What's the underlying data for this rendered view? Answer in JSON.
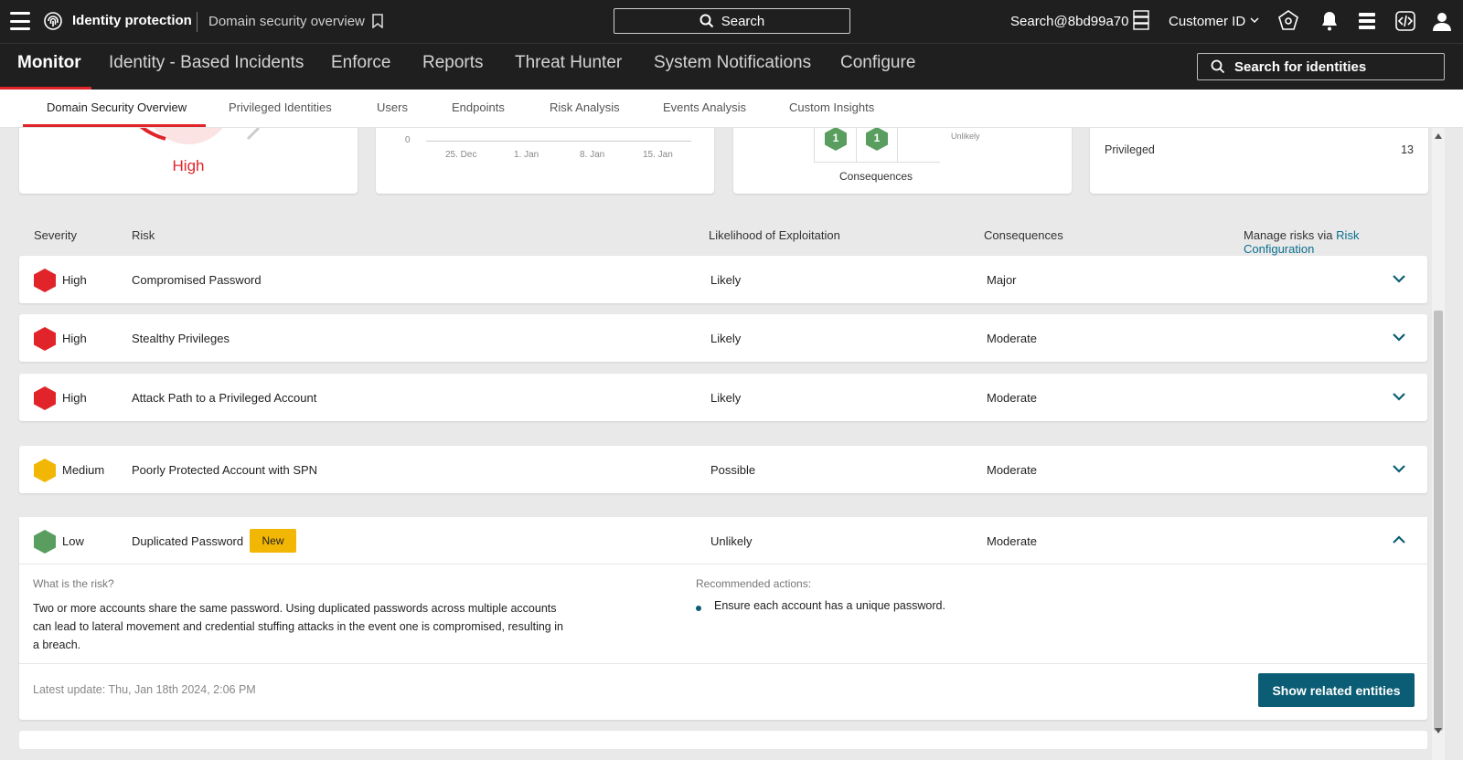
{
  "topbar": {
    "app_name": "Identity protection",
    "page_crumb": "Domain security overview",
    "search_label": "Search",
    "user": "Search@8bd99a70",
    "customer_id": "Customer ID"
  },
  "mainnav": {
    "items": [
      "Monitor",
      "Identity - Based Incidents",
      "Enforce",
      "Reports",
      "Threat Hunter",
      "System Notifications",
      "Configure"
    ],
    "active": "Monitor",
    "identity_search": "Search for identities"
  },
  "subtabs": {
    "items": [
      "Domain Security Overview",
      "Privileged Identities",
      "Users",
      "Endpoints",
      "Risk Analysis",
      "Events Analysis",
      "Custom Insights"
    ],
    "active": "Domain Security Overview"
  },
  "cards": {
    "risk_level": "High",
    "chart_zero": "0",
    "chart_dates": [
      "25. Dec",
      "1. Jan",
      "8. Jan",
      "15. Jan"
    ],
    "matrix_values": [
      "1",
      "1"
    ],
    "matrix_unlikely": "Unlikely",
    "matrix_caption": "Consequences",
    "privileged_label": "Privileged",
    "privileged_count": "13"
  },
  "table": {
    "headers": {
      "severity": "Severity",
      "risk": "Risk",
      "likelihood": "Likelihood of Exploitation",
      "consequences": "Consequences",
      "manage_prefix": "Manage risks via",
      "manage_link": "Risk Configuration"
    },
    "rows": [
      {
        "severity": "High",
        "risk": "Compromised Password",
        "likelihood": "Likely",
        "consequences": "Major"
      },
      {
        "severity": "High",
        "risk": "Stealthy Privileges",
        "likelihood": "Likely",
        "consequences": "Moderate"
      },
      {
        "severity": "High",
        "risk": "Attack Path to a Privileged Account",
        "likelihood": "Likely",
        "consequences": "Moderate"
      },
      {
        "severity": "Medium",
        "risk": "Poorly Protected Account with SPN",
        "likelihood": "Possible",
        "consequences": "Moderate"
      }
    ],
    "expanded": {
      "severity": "Low",
      "risk": "Duplicated Password",
      "badge": "New",
      "likelihood": "Unlikely",
      "consequences": "Moderate",
      "what_label": "What is the risk?",
      "description": "Two or more accounts share the same password. Using duplicated passwords across multiple accounts can lead to lateral movement and credential stuffing attacks in the event one is compromised, resulting in a breach.",
      "rec_label": "Recommended actions:",
      "rec_item": "Ensure each account has a unique password.",
      "latest_update": "Latest update: Thu, Jan 18th 2024, 2:06 PM",
      "button": "Show related entities"
    }
  },
  "colors": {
    "high": "#e0242a",
    "medium": "#f2b705",
    "low": "#5a9e5f",
    "accent": "#0a5d74",
    "link": "#0a6f8f"
  }
}
